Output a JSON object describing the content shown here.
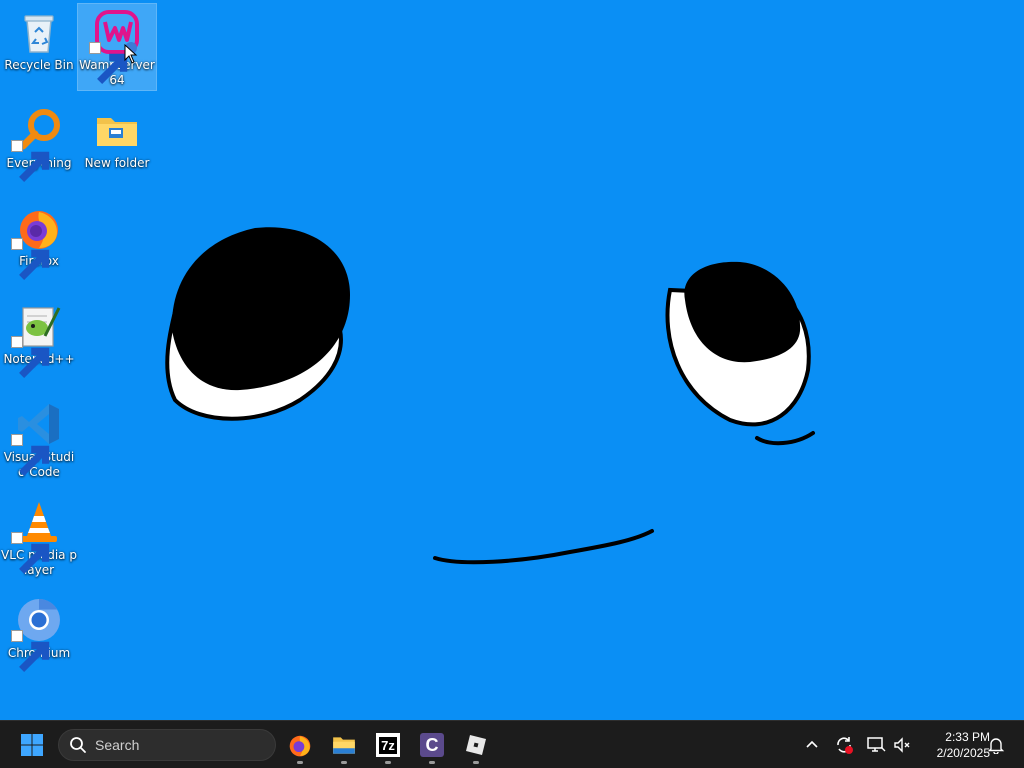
{
  "desktop": {
    "background_color": "#0a8ff5",
    "icons": [
      {
        "label": "Recycle Bin",
        "icon": "recycle-bin-icon"
      },
      {
        "label": "Wampserver64",
        "icon": "wampserver-icon"
      },
      {
        "label": "Everything",
        "icon": "everything-search-icon"
      },
      {
        "label": "New folder",
        "icon": "folder-icon"
      },
      {
        "label": "Firefox",
        "icon": "firefox-icon"
      },
      {
        "label": "Notepad++",
        "icon": "notepad-plus-plus-icon"
      },
      {
        "label": "Visual Studio Code",
        "icon": "vscode-icon"
      },
      {
        "label": "VLC media player",
        "icon": "vlc-icon"
      },
      {
        "label": "Chromium",
        "icon": "chromium-icon"
      }
    ],
    "selected_icon": "Wampserver64"
  },
  "taskbar": {
    "search_placeholder": "Search",
    "pinned_apps": [
      {
        "name": "Firefox",
        "icon": "firefox-icon"
      },
      {
        "name": "File Explorer",
        "icon": "file-explorer-icon"
      },
      {
        "name": "7-Zip",
        "icon": "7zip-icon",
        "text": "7z"
      },
      {
        "name": "CCleaner",
        "icon": "ccleaner-icon",
        "text": "C"
      },
      {
        "name": "Roblox",
        "icon": "roblox-icon"
      }
    ],
    "tray": {
      "time": "2:33 PM",
      "date": "2/20/2025"
    }
  }
}
